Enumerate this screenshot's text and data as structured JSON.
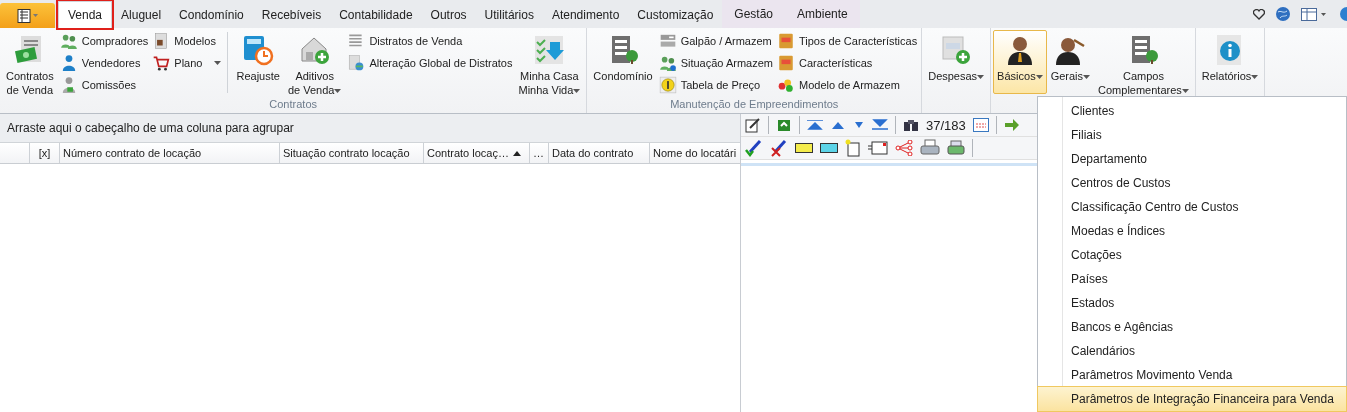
{
  "tabs": [
    {
      "label": "Venda",
      "selected": true,
      "kind": "normal",
      "marked": true
    },
    {
      "label": "Aluguel",
      "selected": false,
      "kind": "normal",
      "marked": false
    },
    {
      "label": "Condomínio",
      "selected": false,
      "kind": "normal",
      "marked": false
    },
    {
      "label": "Recebíveis",
      "selected": false,
      "kind": "normal",
      "marked": false
    },
    {
      "label": "Contabilidade",
      "selected": false,
      "kind": "normal",
      "marked": false
    },
    {
      "label": "Outros",
      "selected": false,
      "kind": "normal",
      "marked": false
    },
    {
      "label": "Utilitários",
      "selected": false,
      "kind": "normal",
      "marked": false
    },
    {
      "label": "Atendimento",
      "selected": false,
      "kind": "normal",
      "marked": false
    },
    {
      "label": "Customização",
      "selected": false,
      "kind": "normal",
      "marked": false
    },
    {
      "label": "Gestão",
      "selected": false,
      "kind": "contextual",
      "marked": false
    },
    {
      "label": "Ambiente",
      "selected": false,
      "kind": "contextual",
      "marked": false
    }
  ],
  "ribbon": [
    {
      "label": "Contratos",
      "columns": [
        {
          "kind": "large",
          "label": "Contratos\nde Venda",
          "dropdown": false,
          "pressed": false
        },
        {
          "kind": "small",
          "items": [
            {
              "label": "Compradores",
              "dropdown": false
            },
            {
              "label": "Vendedores",
              "dropdown": false
            },
            {
              "label": "Comissões",
              "dropdown": false
            }
          ]
        },
        {
          "kind": "small",
          "items": [
            {
              "label": "Modelos",
              "dropdown": false
            },
            {
              "label": "Plano",
              "dropdown": true
            }
          ]
        },
        {
          "kind": "separator"
        },
        {
          "kind": "large",
          "label": "Reajuste",
          "dropdown": false,
          "pressed": false
        },
        {
          "kind": "large",
          "label": "Aditivos\nde Venda",
          "dropdown": true,
          "pressed": false
        },
        {
          "kind": "small",
          "items": [
            {
              "label": "Distratos de Venda",
              "dropdown": false
            },
            {
              "label": "Alteração Global de Distratos",
              "dropdown": false
            }
          ]
        },
        {
          "kind": "large",
          "label": "Minha Casa\nMinha Vida",
          "dropdown": true,
          "pressed": false
        }
      ]
    },
    {
      "label": "Manutenção de Empreendimentos",
      "columns": [
        {
          "kind": "large",
          "label": "Condomínio",
          "dropdown": false,
          "pressed": false
        },
        {
          "kind": "small",
          "items": [
            {
              "label": "Galpão / Armazem",
              "dropdown": false
            },
            {
              "label": "Situação Armazem",
              "dropdown": false
            },
            {
              "label": "Tabela de Preço",
              "dropdown": false
            }
          ]
        },
        {
          "kind": "small",
          "items": [
            {
              "label": "Tipos de Características",
              "dropdown": false
            },
            {
              "label": "Características",
              "dropdown": false
            },
            {
              "label": "Modelo de Armazem",
              "dropdown": false
            }
          ]
        }
      ]
    },
    {
      "columns": [
        {
          "kind": "large",
          "label": "Despesas",
          "dropdown": true,
          "pressed": false
        }
      ]
    },
    {
      "columns": [
        {
          "kind": "large",
          "label": "Básicos",
          "dropdown": true,
          "pressed": true
        },
        {
          "kind": "large",
          "label": "Gerais",
          "dropdown": true,
          "pressed": false
        },
        {
          "kind": "large",
          "label": "Campos\nComplementares",
          "dropdown": true,
          "pressed": false
        }
      ]
    },
    {
      "columns": [
        {
          "kind": "large",
          "label": "Relatórios",
          "dropdown": true,
          "pressed": false
        }
      ]
    }
  ],
  "grid": {
    "group_hint": "Arraste aqui o cabeçalho de uma coluna para agrupar",
    "columns": [
      {
        "label": "[x]",
        "sorted": false
      },
      {
        "label": "Número contrato de locação",
        "sorted": false
      },
      {
        "label": "Situação contrato locação",
        "sorted": false
      },
      {
        "label": "Contrato locaç…",
        "sorted": true
      },
      {
        "label": "…",
        "sorted": false
      },
      {
        "label": "Data do contrato",
        "sorted": false
      },
      {
        "label": "Nome do locatári",
        "sorted": false
      }
    ]
  },
  "navigator": {
    "record_counter": "37/183"
  },
  "dropdown_menu": [
    {
      "label": "Clientes",
      "selected": false
    },
    {
      "label": "Filiais",
      "selected": false
    },
    {
      "label": "Departamento",
      "selected": false
    },
    {
      "label": "Centros de Custos",
      "selected": false
    },
    {
      "label": "Classificação Centro de Custos",
      "selected": false
    },
    {
      "label": "Moedas e Índices",
      "selected": false
    },
    {
      "label": "Cotações",
      "selected": false
    },
    {
      "label": "Países",
      "selected": false
    },
    {
      "label": "Estados",
      "selected": false
    },
    {
      "label": "Bancos e Agências",
      "selected": false
    },
    {
      "label": "Calendários",
      "selected": false
    },
    {
      "label": "Parâmetros Movimento Venda",
      "selected": false
    },
    {
      "label": "Parâmetros de Integração Financeira para Venda",
      "selected": true
    }
  ]
}
